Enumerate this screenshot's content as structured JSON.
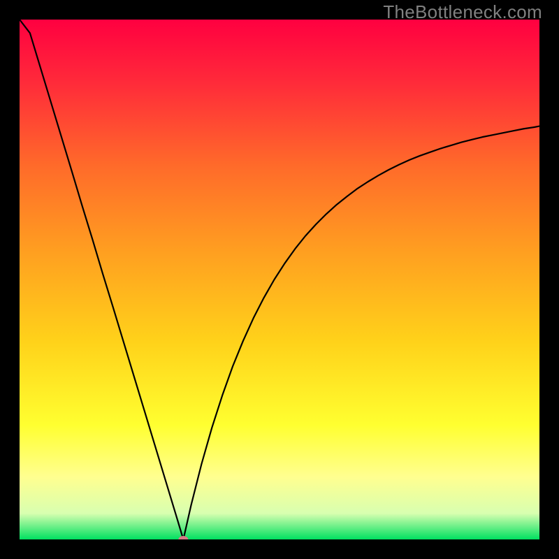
{
  "watermark": {
    "text": "TheBottleneck.com"
  },
  "colors": {
    "background_outer": "#000000",
    "curve_stroke": "#000000",
    "marker_fill": "#d67a86",
    "gradient_stops": [
      {
        "offset": 0.0,
        "color": "#ff0040"
      },
      {
        "offset": 0.12,
        "color": "#ff2a3a"
      },
      {
        "offset": 0.28,
        "color": "#ff6a2a"
      },
      {
        "offset": 0.45,
        "color": "#ffa020"
      },
      {
        "offset": 0.62,
        "color": "#ffd21a"
      },
      {
        "offset": 0.78,
        "color": "#ffff30"
      },
      {
        "offset": 0.88,
        "color": "#ffff90"
      },
      {
        "offset": 0.95,
        "color": "#d8ffb0"
      },
      {
        "offset": 1.0,
        "color": "#00e060"
      }
    ]
  },
  "chart_data": {
    "type": "line",
    "title": "",
    "xlabel": "",
    "ylabel": "",
    "xlim": [
      0,
      1
    ],
    "ylim": [
      0,
      1
    ],
    "optimum_x": 0.315,
    "left_slope": 3.3,
    "right": {
      "asymptote": 0.88,
      "rate": 5.2
    },
    "marker": {
      "x": 0.315,
      "y": 0.0
    },
    "x": [
      0.0,
      0.02,
      0.04,
      0.06,
      0.08,
      0.1,
      0.12,
      0.14,
      0.16,
      0.18,
      0.2,
      0.22,
      0.24,
      0.26,
      0.28,
      0.3,
      0.315,
      0.33,
      0.35,
      0.37,
      0.39,
      0.41,
      0.43,
      0.45,
      0.47,
      0.49,
      0.51,
      0.53,
      0.55,
      0.57,
      0.59,
      0.61,
      0.63,
      0.65,
      0.67,
      0.69,
      0.71,
      0.73,
      0.75,
      0.77,
      0.79,
      0.81,
      0.83,
      0.85,
      0.87,
      0.89,
      0.91,
      0.93,
      0.95,
      0.97,
      0.99,
      1.0
    ],
    "values": [
      1.0,
      0.974,
      0.908,
      0.842,
      0.776,
      0.71,
      0.643,
      0.578,
      0.511,
      0.446,
      0.38,
      0.314,
      0.248,
      0.182,
      0.116,
      0.05,
      0.0,
      0.066,
      0.145,
      0.215,
      0.277,
      0.333,
      0.382,
      0.426,
      0.465,
      0.5,
      0.531,
      0.559,
      0.584,
      0.606,
      0.626,
      0.644,
      0.66,
      0.675,
      0.688,
      0.7,
      0.711,
      0.721,
      0.73,
      0.738,
      0.745,
      0.752,
      0.758,
      0.764,
      0.769,
      0.774,
      0.778,
      0.782,
      0.786,
      0.79,
      0.793,
      0.795
    ]
  }
}
